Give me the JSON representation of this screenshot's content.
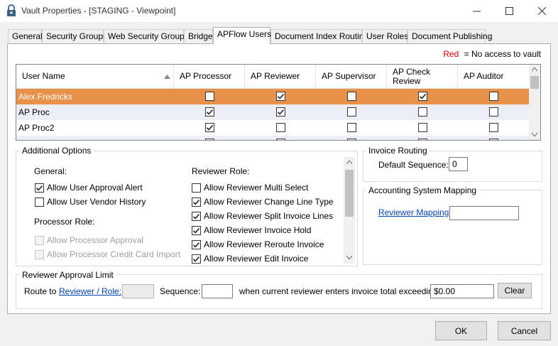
{
  "window": {
    "title": "Vault Properties - [STAGING - Viewpoint]",
    "controls": [
      "minimize",
      "maximize",
      "close"
    ]
  },
  "tabs": [
    {
      "label": "General"
    },
    {
      "label": "Security Groups"
    },
    {
      "label": "Web Security Groups"
    },
    {
      "label": "Bridge"
    },
    {
      "label": "APFlow Users",
      "active": true
    },
    {
      "label": "Document Index Routing"
    },
    {
      "label": "User Roles"
    },
    {
      "label": "Document Publishing"
    }
  ],
  "legend": {
    "marker": "Red",
    "text": "= No access to vault"
  },
  "grid": {
    "columns": [
      "User Name",
      "AP Processor",
      "AP Reviewer",
      "AP Supervisor",
      "AP Check Review",
      "AP Auditor"
    ],
    "rows": [
      {
        "name": "Alex Fredricks",
        "selected": true,
        "checks": [
          false,
          true,
          false,
          true,
          false
        ]
      },
      {
        "name": "AP Proc",
        "checks": [
          true,
          true,
          false,
          false,
          false
        ]
      },
      {
        "name": "AP Proc2",
        "checks": [
          true,
          false,
          false,
          false,
          false
        ]
      },
      {
        "name": "",
        "partial": true,
        "checks": [
          false,
          true,
          false,
          false,
          false
        ]
      }
    ],
    "colors": {
      "selected_row": "#e8914b",
      "alt_row": "#eeeef9"
    }
  },
  "additional_options": {
    "title": "Additional Options",
    "general": {
      "heading": "General:",
      "items": [
        {
          "label": "Allow User Approval Alert",
          "checked": true
        },
        {
          "label": "Allow User Vendor History",
          "checked": false
        }
      ]
    },
    "processor": {
      "heading": "Processor Role:",
      "items": [
        {
          "label": "Allow Processor Approval",
          "checked": false,
          "disabled": true
        },
        {
          "label": "Allow Processor Credit Card Import",
          "checked": false,
          "disabled": true
        }
      ]
    },
    "reviewer": {
      "heading": "Reviewer Role:",
      "items": [
        {
          "label": "Allow Reviewer Multi Select",
          "checked": false
        },
        {
          "label": "Allow Reviewer Change Line Type",
          "checked": true
        },
        {
          "label": "Allow Reviewer Split Invoice Lines",
          "checked": true
        },
        {
          "label": "Allow Reviewer Invoice Hold",
          "checked": true
        },
        {
          "label": "Allow Reviewer Reroute Invoice",
          "checked": true
        },
        {
          "label": "Allow Reviewer Edit Invoice",
          "checked": true
        }
      ]
    }
  },
  "invoice_routing": {
    "title": "Invoice Routing",
    "default_sequence_label": "Default Sequence:",
    "default_sequence_value": "0"
  },
  "accounting_mapping": {
    "title": "Accounting System Mapping",
    "link_label": "Reviewer Mapping:",
    "value": ""
  },
  "approval_limit": {
    "title": "Reviewer Approval Limit",
    "route_to_label": "Route to",
    "role_link": "Reviewer / Role:",
    "role_value": "",
    "sequence_label": "Sequence:",
    "sequence_value": "",
    "condition_label": "when current reviewer enters invoice total exceeding:",
    "amount_value": "$0.00",
    "clear_label": "Clear"
  },
  "footer": {
    "ok_label": "OK",
    "cancel_label": "Cancel"
  }
}
